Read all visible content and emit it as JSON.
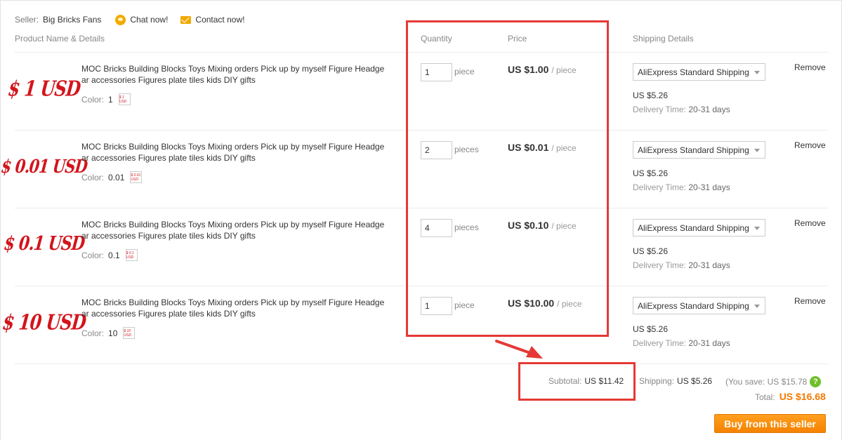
{
  "seller": {
    "label": "Seller:",
    "name": "Big Bricks Fans",
    "chat": "Chat now!",
    "contact": "Contact now!"
  },
  "header": {
    "product": "Product Name & Details",
    "quantity": "Quantity",
    "price": "Price",
    "shipping": "Shipping Details"
  },
  "items": [
    {
      "thumb": "$ 1 USD",
      "title": "MOC Bricks Building Blocks Toys Mixing orders Pick up by myself Figure Headgear accessories Figures plate tiles kids DIY gifts",
      "color_label": "Color:",
      "color_value": "1",
      "qty": "1",
      "unit": "piece",
      "price": "US $1.00",
      "per": "/ piece",
      "shipping_method": "AliExpress Standard Shipping",
      "shipping_cost": "US $5.26",
      "delivery_label": "Delivery Time:",
      "delivery_value": "20-31 days",
      "remove": "Remove"
    },
    {
      "thumb": "$ 0.01 USD",
      "title": "MOC Bricks Building Blocks Toys Mixing orders Pick up by myself Figure Headgear accessories Figures plate tiles kids DIY gifts",
      "color_label": "Color:",
      "color_value": "0.01",
      "qty": "2",
      "unit": "pieces",
      "price": "US $0.01",
      "per": "/ piece",
      "shipping_method": "AliExpress Standard Shipping",
      "shipping_cost": "US $5.26",
      "delivery_label": "Delivery Time:",
      "delivery_value": "20-31 days",
      "remove": "Remove"
    },
    {
      "thumb": "$ 0.1 USD",
      "title": "MOC Bricks Building Blocks Toys Mixing orders Pick up by myself Figure Headgear accessories Figures plate tiles kids DIY gifts",
      "color_label": "Color:",
      "color_value": "0.1",
      "qty": "4",
      "unit": "pieces",
      "price": "US $0.10",
      "per": "/ piece",
      "shipping_method": "AliExpress Standard Shipping",
      "shipping_cost": "US $5.26",
      "delivery_label": "Delivery Time:",
      "delivery_value": "20-31 days",
      "remove": "Remove"
    },
    {
      "thumb": "$ 10 USD",
      "title": "MOC Bricks Building Blocks Toys Mixing orders Pick up by myself Figure Headgear accessories Figures plate tiles kids DIY gifts",
      "color_label": "Color:",
      "color_value": "10",
      "qty": "1",
      "unit": "piece",
      "price": "US $10.00",
      "per": "/ piece",
      "shipping_method": "AliExpress Standard Shipping",
      "shipping_cost": "US $5.26",
      "delivery_label": "Delivery Time:",
      "delivery_value": "20-31 days",
      "remove": "Remove"
    }
  ],
  "summary": {
    "subtotal_label": "Subtotal:",
    "subtotal_value": "US $11.42",
    "shipping_label": "Shipping:",
    "shipping_value": "US $5.26",
    "save_text": "(You save: US $15.78",
    "total_label": "Total:",
    "total_value": "US $16.68",
    "buy_button": "Buy from this seller"
  },
  "colors": {
    "accent_orange": "#f58200",
    "total_orange": "#f47a00",
    "annotation_red": "#e53935",
    "thumb_red": "#d3141c",
    "help_green": "#6fbf2a"
  }
}
